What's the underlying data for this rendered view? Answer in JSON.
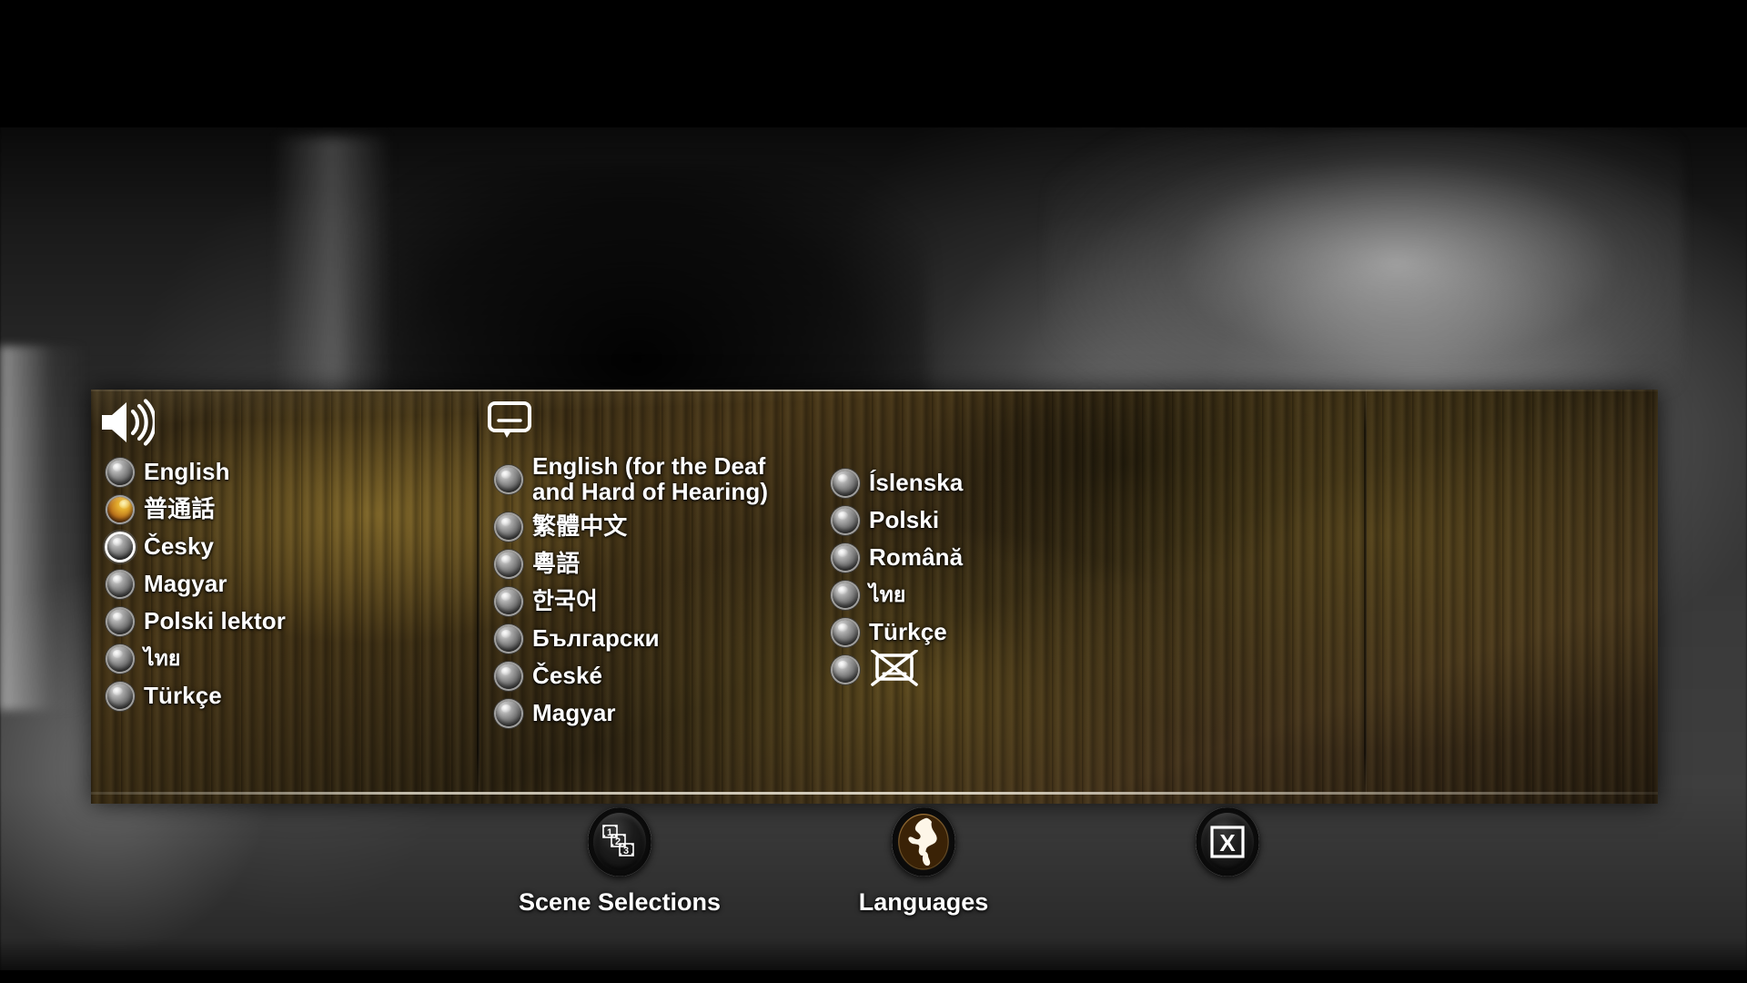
{
  "menu": {
    "audio_section": {
      "icon": "speaker-icon",
      "items": [
        {
          "label": "English",
          "selected": false,
          "focused": false,
          "script": "latin"
        },
        {
          "label": "普通話",
          "selected": true,
          "focused": false,
          "script": "cjk"
        },
        {
          "label": "Česky",
          "selected": false,
          "focused": true,
          "script": "latin"
        },
        {
          "label": "Magyar",
          "selected": false,
          "focused": false,
          "script": "latin"
        },
        {
          "label": "Polski lektor",
          "selected": false,
          "focused": false,
          "script": "latin"
        },
        {
          "label": "ไทย",
          "selected": false,
          "focused": false,
          "script": "thai"
        },
        {
          "label": "Türkçe",
          "selected": false,
          "focused": false,
          "script": "latin"
        }
      ]
    },
    "subtitle_section": {
      "icon": "subtitle-icon",
      "column_one": [
        {
          "label": "English (for the Deaf\nand Hard of Hearing)",
          "selected": false,
          "focused": false,
          "script": "latin",
          "two_line": true
        },
        {
          "label": "繁體中文",
          "selected": false,
          "focused": false,
          "script": "cjk"
        },
        {
          "label": "粵語",
          "selected": false,
          "focused": false,
          "script": "cjk"
        },
        {
          "label": "한국어",
          "selected": false,
          "focused": false,
          "script": "cjk"
        },
        {
          "label": "Български",
          "selected": false,
          "focused": false,
          "script": "latin"
        },
        {
          "label": "České",
          "selected": false,
          "focused": false,
          "script": "latin"
        },
        {
          "label": "Magyar",
          "selected": false,
          "focused": false,
          "script": "latin"
        }
      ],
      "column_two": [
        {
          "label": "Íslenska",
          "selected": false,
          "focused": false,
          "script": "latin"
        },
        {
          "label": "Polski",
          "selected": false,
          "focused": false,
          "script": "latin"
        },
        {
          "label": "Română",
          "selected": false,
          "focused": false,
          "script": "latin"
        },
        {
          "label": "ไทย",
          "selected": false,
          "focused": false,
          "script": "thai"
        },
        {
          "label": "Türkçe",
          "selected": false,
          "focused": false,
          "script": "latin"
        },
        {
          "label": "",
          "selected": false,
          "focused": false,
          "script": "icon",
          "icon": "subtitles-off-icon"
        }
      ]
    },
    "nav": [
      {
        "label": "Scene Selections",
        "icon": "scene-selections-icon"
      },
      {
        "label": "Languages",
        "icon": "globe-icon"
      },
      {
        "label": "",
        "icon": "exit-x-icon"
      }
    ]
  },
  "colors": {
    "selected_radio": "#e2aa2c",
    "focus_ring": "#ffffff",
    "text": "#ffffff",
    "panel_wood_dark": "#2a2110",
    "panel_wood_light": "#8a7030"
  }
}
